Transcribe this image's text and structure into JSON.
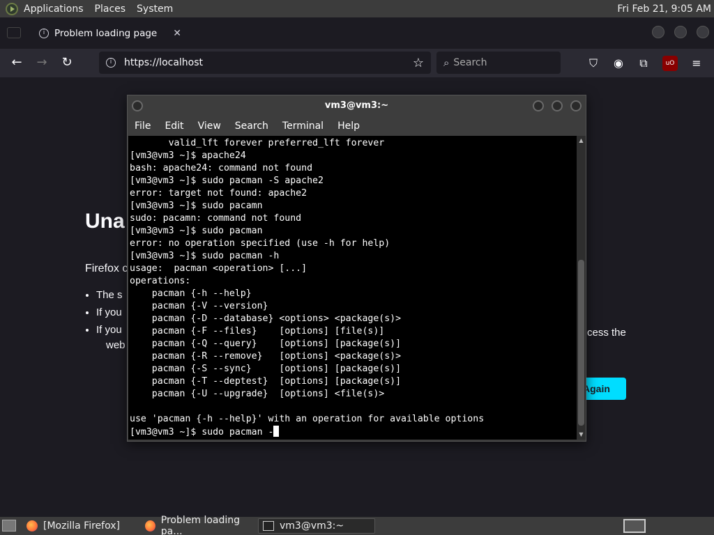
{
  "top_panel": {
    "menus": [
      "Applications",
      "Places",
      "System"
    ],
    "clock": "Fri Feb 21,  9:05 AM"
  },
  "firefox": {
    "tab_title": "Problem loading page",
    "url": "https://localhost",
    "search_placeholder": "Search"
  },
  "page": {
    "heading": "Una",
    "desc_start": "Firefox c",
    "bullets": [
      "The s",
      "If you",
      "If you"
    ],
    "right_fragment": "cess the",
    "left_fragment": "web",
    "button_fragment": "Again"
  },
  "terminal": {
    "title": "vm3@vm3:~",
    "menu": [
      "File",
      "Edit",
      "View",
      "Search",
      "Terminal",
      "Help"
    ],
    "lines": [
      "       valid_lft forever preferred_lft forever",
      "[vm3@vm3 ~]$ apache24",
      "bash: apache24: command not found",
      "[vm3@vm3 ~]$ sudo pacman -S apache2",
      "error: target not found: apache2",
      "[vm3@vm3 ~]$ sudo pacamn",
      "sudo: pacamn: command not found",
      "[vm3@vm3 ~]$ sudo pacman",
      "error: no operation specified (use -h for help)",
      "[vm3@vm3 ~]$ sudo pacman -h",
      "usage:  pacman <operation> [...]",
      "operations:",
      "    pacman {-h --help}",
      "    pacman {-V --version}",
      "    pacman {-D --database} <options> <package(s)>",
      "    pacman {-F --files}    [options] [file(s)]",
      "    pacman {-Q --query}    [options] [package(s)]",
      "    pacman {-R --remove}   [options] <package(s)>",
      "    pacman {-S --sync}     [options] [package(s)]",
      "    pacman {-T --deptest}  [options] [package(s)]",
      "    pacman {-U --upgrade}  [options] <file(s)>",
      "",
      "use 'pacman {-h --help}' with an operation for available options"
    ],
    "prompt_line": "[vm3@vm3 ~]$ sudo pacman -"
  },
  "taskbar": {
    "tasks": [
      "[Mozilla Firefox]",
      "Problem loading pa...",
      "vm3@vm3:~"
    ]
  }
}
